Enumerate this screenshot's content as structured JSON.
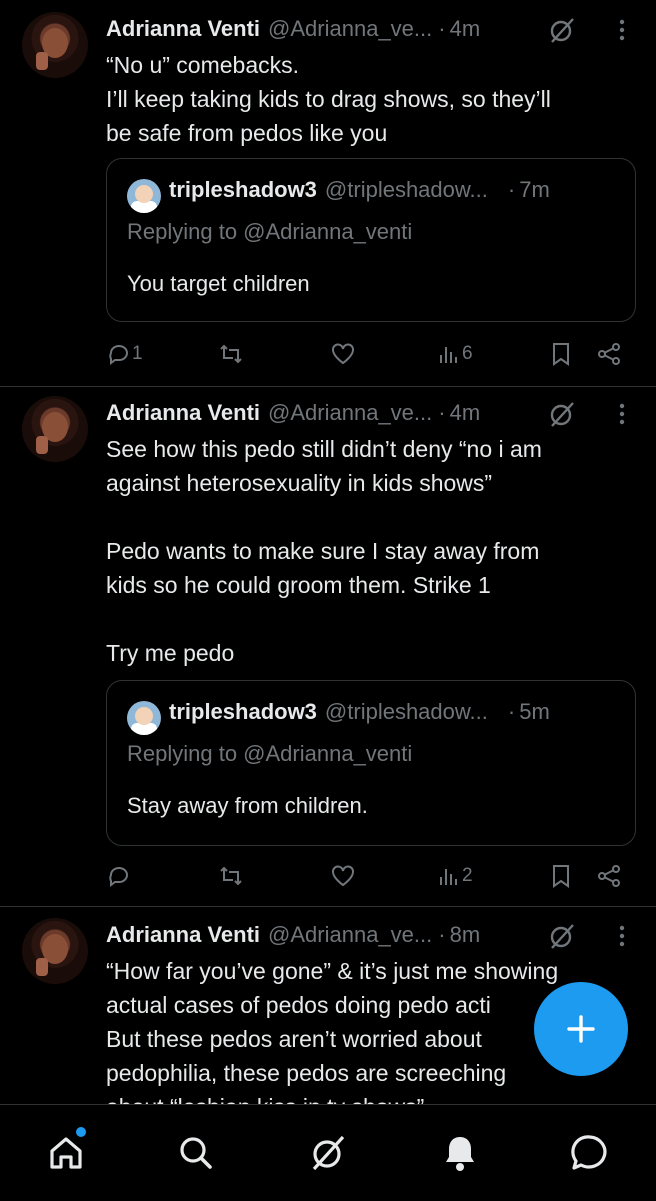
{
  "colors": {
    "accent": "#1d9bf0",
    "muted": "#71767b",
    "text": "#e7e9ea",
    "divider": "#2f3336"
  },
  "tweets": [
    {
      "name": "Adrianna Venti",
      "handle": "@Adrianna_ve...",
      "time": "4m",
      "lines": [
        "“No u” comebacks.",
        "I’ll keep taking kids to drag shows, so they’ll",
        "be safe from pedos like you"
      ],
      "quote": {
        "name": "tripleshadow3",
        "handle": "@tripleshadow...",
        "time": "7m",
        "reply": "Replying to @Adrianna_venti",
        "text": "You target children"
      },
      "replies": "1",
      "views": "6"
    },
    {
      "name": "Adrianna Venti",
      "handle": "@Adrianna_ve...",
      "time": "4m",
      "lines": [
        "See how this pedo still didn’t deny “no i am",
        "against heterosexuality in kids shows”",
        "",
        "Pedo wants to make sure I stay away from",
        "kids so he could groom them. Strike 1",
        "",
        "Try me pedo"
      ],
      "quote": {
        "name": "tripleshadow3",
        "handle": "@tripleshadow...",
        "time": "5m",
        "reply": "Replying to @Adrianna_venti",
        "text": "Stay away from children."
      },
      "replies": "",
      "views": "2"
    },
    {
      "name": "Adrianna Venti",
      "handle": "@Adrianna_ve...",
      "time": "8m",
      "lines": [
        "“How far you’ve gone” & it’s just me showing",
        "actual cases of pedos doing pedo acti",
        "But these pedos aren’t worried about",
        "pedophilia, these pedos are screeching",
        "about “lesbian kiss in tv shows”"
      ]
    }
  ],
  "icons": {
    "reply": "reply-icon",
    "retweet": "retweet-icon",
    "like": "like-icon",
    "views": "views-icon",
    "bookmark": "bookmark-icon",
    "share": "share-icon",
    "grok": "grok-icon",
    "more": "more-icon",
    "compose": "compose-icon",
    "home": "home-icon",
    "search": "search-icon",
    "notifications": "bell-icon",
    "messages": "messages-icon"
  }
}
